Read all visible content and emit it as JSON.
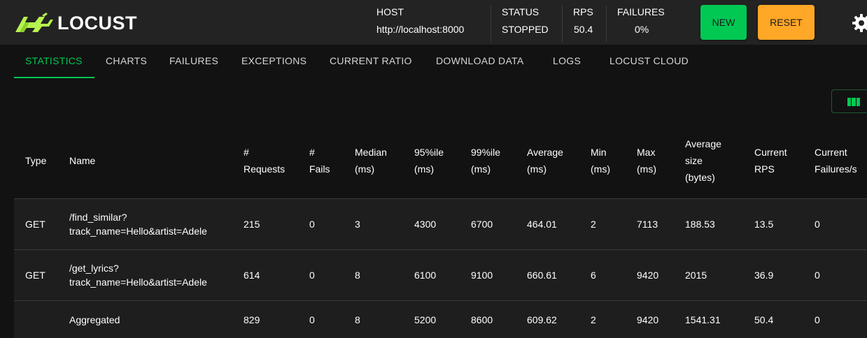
{
  "app": {
    "logo_text": "LOCUST",
    "brand_color": "#00c853"
  },
  "header": {
    "host": {
      "label": "HOST",
      "value": "http://localhost:8000"
    },
    "status": {
      "label": "STATUS",
      "value": "STOPPED"
    },
    "rps": {
      "label": "RPS",
      "value": "50.4"
    },
    "failures": {
      "label": "FAILURES",
      "value": "0%"
    },
    "new_button": "NEW",
    "reset_button": "RESET",
    "settings_icon": "gear-icon"
  },
  "tabs": [
    {
      "label": "STATISTICS",
      "active": true
    },
    {
      "label": "CHARTS",
      "active": false
    },
    {
      "label": "FAILURES",
      "active": false
    },
    {
      "label": "EXCEPTIONS",
      "active": false
    },
    {
      "label": "CURRENT RATIO",
      "active": false
    },
    {
      "label": "DOWNLOAD DATA",
      "active": false
    },
    {
      "label": "LOGS",
      "active": false
    },
    {
      "label": "LOCUST CLOUD",
      "active": false
    }
  ],
  "toolbar": {
    "columns_icon": "view-column-icon"
  },
  "table": {
    "headers": [
      [
        "Type"
      ],
      [
        "Name"
      ],
      [
        "#",
        "Requests"
      ],
      [
        "#",
        "Fails"
      ],
      [
        "Median",
        "(ms)"
      ],
      [
        "95%ile",
        "(ms)"
      ],
      [
        "99%ile",
        "(ms)"
      ],
      [
        "Average",
        "(ms)"
      ],
      [
        "Min",
        "(ms)"
      ],
      [
        "Max",
        "(ms)"
      ],
      [
        "Average",
        "size",
        "(bytes)"
      ],
      [
        "Current",
        "RPS"
      ],
      [
        "Current",
        "Failures/s"
      ]
    ],
    "rows": [
      {
        "type": "GET",
        "name": [
          "/find_similar?",
          "track_name=Hello&artist=Adele"
        ],
        "requests": "215",
        "fails": "0",
        "median": "3",
        "p95": "4300",
        "p99": "6700",
        "average": "464.01",
        "min": "2",
        "max": "7113",
        "avg_size": "188.53",
        "current_rps": "13.5",
        "current_failures": "0"
      },
      {
        "type": "GET",
        "name": [
          "/get_lyrics?",
          "track_name=Hello&artist=Adele"
        ],
        "requests": "614",
        "fails": "0",
        "median": "8",
        "p95": "6100",
        "p99": "9100",
        "average": "660.61",
        "min": "6",
        "max": "9420",
        "avg_size": "2015",
        "current_rps": "36.9",
        "current_failures": "0"
      },
      {
        "type": "",
        "name": [
          "Aggregated"
        ],
        "requests": "829",
        "fails": "0",
        "median": "8",
        "p95": "5200",
        "p99": "8600",
        "average": "609.62",
        "min": "2",
        "max": "9420",
        "avg_size": "1541.31",
        "current_rps": "50.4",
        "current_failures": "0"
      }
    ]
  }
}
